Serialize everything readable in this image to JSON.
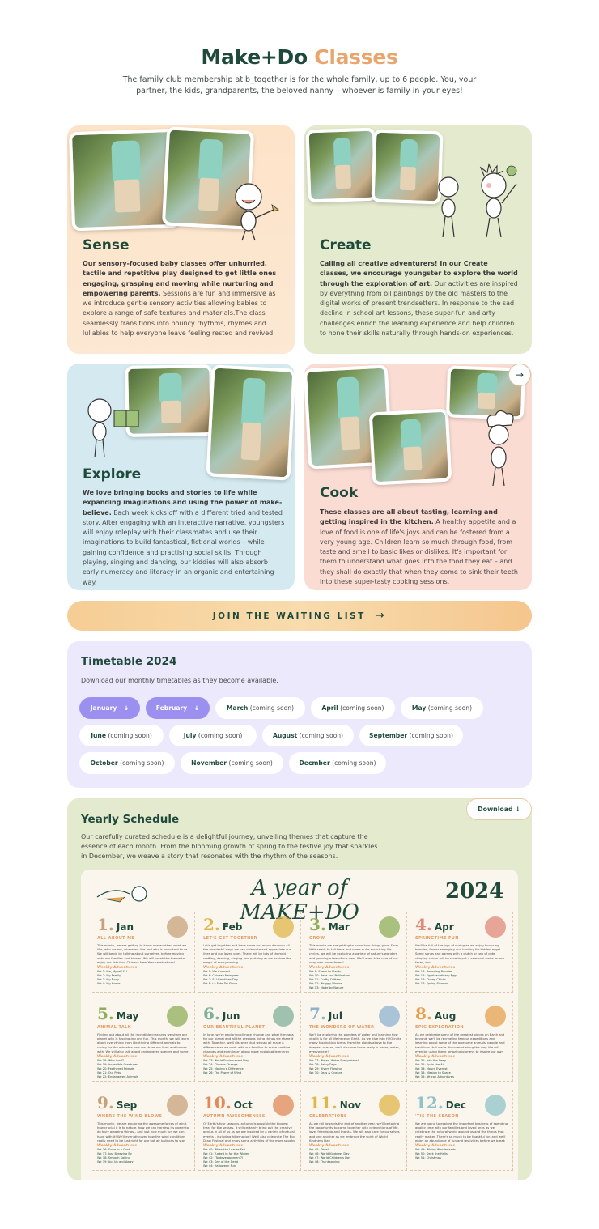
{
  "hero": {
    "title_main": "Make+Do",
    "title_accent": "Classes",
    "subtitle": "The family club membership at b_together is for the whole family, up to 6 people. You, your partner, the kids, grandparents, the beloved nanny – whoever is family in your eyes!"
  },
  "classes": [
    {
      "title": "Sense",
      "lead": "Our sensory-focused baby classes offer unhurried, tactile and repetitive play designed to get little ones engaging, grasping and moving while nurturing and empowering parents.",
      "body": " Sessions are fun and immersive as we introduce gentle sensory activities allowing babies to explore a range of safe textures and materials.The class seamlessly transitions into bouncy rhythms, rhymes and lullabies to help everyone leave feeling rested and revived."
    },
    {
      "title": "Create",
      "lead": "Calling all creative adventurers! In our Create classes, we encourage youngster to explore the world through the exploration of art.",
      "body": " Our activities are inspired by everything from oil paintings by the old masters to the digital works of present trendsetters. In response to the sad decline in school art lessons, these super-fun and arty challenges enrich the learning experience and help children to hone their skills naturally through hands-on experiences."
    },
    {
      "title": "Explore",
      "lead": "We love bringing books and stories to life while expanding imaginations and using the power of make-believe.",
      "body": " Each week kicks off with a different tried and tested story. After engaging with an interactive narrative, youngsters will enjoy roleplay with their classmates and use their imaginations to build fantastical, fictional worlds – while gaining confidence and practising social skills. Through playing, singing and dancing, our kiddies will also absorb early numeracy and literacy in an organic and entertaining way."
    },
    {
      "title": "Cook",
      "lead": "These classes are all about tasting, learning and getting inspired in the kitchen.",
      "body": " A healthy appetite and a love of food is one of life's joys and can be fostered from a very young age. Children learn so much through food, from taste and smell to basic likes or dislikes. It's important for them to understand what goes into the food they eat – and they shall do exactly that when they come to sink their teeth into these super-tasty cooking sessions."
    }
  ],
  "carousel": {
    "next_icon": "→"
  },
  "join": {
    "label": "JOIN THE WAITING LIST",
    "icon": "→"
  },
  "timetable": {
    "title": "Timetable 2024",
    "note": "Download our monthly timetables as they become available.",
    "months": [
      {
        "name": "January",
        "status": "",
        "icon": "↓"
      },
      {
        "name": "February",
        "status": "",
        "icon": "↓"
      },
      {
        "name": "March",
        "status": "(coming soon)"
      },
      {
        "name": "April",
        "status": "(coming soon)"
      },
      {
        "name": "May",
        "status": "(coming soon)"
      },
      {
        "name": "June",
        "status": "(coming soon)"
      },
      {
        "name": "July",
        "status": "(coming soon)"
      },
      {
        "name": "August",
        "status": "(coming soon)"
      },
      {
        "name": "September",
        "status": "(coming soon)"
      },
      {
        "name": "October",
        "status": "(coming soon)"
      },
      {
        "name": "November",
        "status": "(coming soon)"
      },
      {
        "name": "Decmber",
        "status": "(coming soon)"
      }
    ]
  },
  "yearly": {
    "title": "Yearly Schedule",
    "desc": "Our carefully curated schedule is a delightful journey, unveiling themes that capture the essence of each month. From the blooming growth of spring to the festive joy that sparkles in December, we weave a story that resonates with the rhythm of the seasons.",
    "download_label": "Download",
    "download_icon": "↓",
    "poster": {
      "title": "A year of MAKE+DO",
      "year": "2024",
      "weekly_label": "Weekly Adventures",
      "months": [
        {
          "num": "1.",
          "name": "Jan",
          "theme": "ALL ABOUT ME",
          "color": "#c5a27a",
          "body": "This month, we are getting to know one another, what we like, who we are, where we live and who is important to us. We will begin by talking about ourselves, before moving onto our families and homes. We will break the theme to enjoy our fabulous Chinese New Year celebrations!",
          "weeks": [
            "Wk 1: Me, Myself & I",
            "Wk 2: My Family",
            "Wk 3: My Body",
            "Wk 4: My Home"
          ]
        },
        {
          "num": "2.",
          "name": "Feb",
          "theme": "LET'S GET TOGETHER",
          "color": "#e0b54a",
          "body": "Let's get together and have some fun as we discover all the wonderful ways we can celebrate and appreciate our lives and our loved ones. There will be lots of themed crafting, dancing, singing and partying as we explore the magic of merrymaking.",
          "weeks": [
            "Wk 5: We Connect",
            "Wk 6: Chinese New year",
            "Wk 7: St Valentines Day",
            "Wk 8: La Fete Du Slinos"
          ]
        },
        {
          "num": "3.",
          "name": "Mar",
          "theme": "GROW",
          "color": "#8fae5a",
          "body": "This month we are getting to know how things grow. From little seeds to tall trees and some quite surprising life cycles, we will be exploring a variety of nature's wonders and growing a few of our own. We'll even take care of our very own worm farms!",
          "weeks": [
            "Wk 9: Seeds to Plants",
            "Wk 10: Bees and Pollinators",
            "Wk 11: Crafty Critters",
            "Wk 12: Wriggly Worms",
            "Wk 13: Made by Nature"
          ]
        },
        {
          "num": "4.",
          "name": "Apr",
          "theme": "SPRINGTIME FUN",
          "color": "#e08a7a",
          "body": "We'll be full of the joys of spring as we enjoy bouncing bunnies, flower arranging and hunting for hidden eggs! Some songs and games with a clutch or two of cute chirping chicks will be sure to put a seasonal smile on our faces, too!",
          "weeks": [
            "Wk 14: Bouncing Bunnies",
            "Wk 15: Eggstraordinary Eggs",
            "Wk 16: Cheep Chicks",
            "Wk 17: Spring Flowers"
          ]
        },
        {
          "num": "5.",
          "name": "May",
          "theme": "ANIMAL TALK",
          "color": "#8fae5a",
          "body": "Finding out about all the incredible creatures we share our planet with is fascinating and fun. This month, we will learn about everything from identifying different animals to caring for the adorable pets we share our lives and homes with. We will also talk about endangered species and some of the things we can all do to support their conservation.",
          "weeks": [
            "Wk 18: Who Am I?",
            "Wk 19: Incredible Creatures",
            "Wk 20: Feathered Friends",
            "Wk 21: Our Pets",
            "Wk 22: Endangered Animals"
          ]
        },
        {
          "num": "6.",
          "name": "Jun",
          "theme": "OUR BEAUTIFUL PLANET",
          "color": "#7fb09a",
          "body": "In June, we're exploring climate change and what it means for our planet and all the precious living things we share it with. Together, we'll discover that we can all make a difference as we work with our families to make positive changes and even learn about more sustainable energy sources.",
          "weeks": [
            "Wk 23: World Environment Day",
            "Wk 24: Climate Change",
            "Wk 25: Making a Difference",
            "Wk 26: The Power of Wind"
          ]
        },
        {
          "num": "7.",
          "name": "Jul",
          "theme": "THE WONDERS OF WATER",
          "color": "#8fb3cf",
          "body": "We'll be exploring the wonders of water and learning how vital it is for all life here on Earth. As we dive into H2O in its many fascinating forms, from the clouds above to the deepest oceans, we'll discover there really is water, water, everywhere!",
          "weeks": [
            "Wk 27: Water, Water Everywhere!",
            "Wk 28: Rainy Days",
            "Wk 29: Rivers Flowing",
            "Wk 30: Seas & Oceans"
          ]
        },
        {
          "num": "8.",
          "name": "Aug",
          "theme": "EPIC EXPLORATION",
          "color": "#e6a14f",
          "body": "As we celebrate some of the greatest places on Earth and beyond, we'll be recreating famous expeditions and learning about some of the awesome animals, people and traditions that we're discovered along the way. We will even be using these amazing journeys to inspire our own daring adventures!",
          "weeks": [
            "Wk 31: Into the Deep",
            "Wk 32: Up in the Air",
            "Wk 33: Mount Everest",
            "Wk 34: Mission to Space",
            "Wk 35: African Adventures"
          ]
        },
        {
          "num": "9.",
          "name": "Sep",
          "theme": "WHERE THE WIND BLOWS",
          "color": "#c5a27a",
          "body": "This month, we are exploring the awesome forces of wind, how crucial it is to nature, how we can harness its power to do truly amazing things – and just how much fun we can have with it! We'll even discover how the wind conditions really need to be just right for our hot air balloons to stay on course!",
          "weeks": [
            "Wk 36: Gone in a Gust",
            "Wk 37: Just Breezing By",
            "Wk 38: Smooth Sailing",
            "Wk 39: Up, Up and Away!"
          ]
        },
        {
          "num": "10.",
          "name": "Oct",
          "theme": "AUTUMN AWESOMENESS",
          "color": "#e08a5a",
          "body": "Of Earth's four seasons, autumn is possibly the biggest treat for the senses. It will certainly bring out the creative genius in all of us as we are inspired by a variety of natural events – including hibernation! We'll also celebrate The Big Draw Festival and enjoy some activities of the more spooky variety.",
          "weeks": [
            "Wk 40: When the Leaves Fall",
            "Wk 41: Tucked in for the Winter",
            "Wk 42: (To developpment?)",
            "Wk 43: Day of the Dead",
            "Wk 44: Halloween Fun"
          ]
        },
        {
          "num": "11.",
          "name": "Nov",
          "theme": "CELEBRATIONS",
          "color": "#e0b54a",
          "body": "As we roll towards the end of another year, we'll be taking the opportunity to come together with celebrations of life, love, friendship and thanks. We will also care for ourselves and one another as we embrace the spirit of World Kindness Day.",
          "weeks": [
            "Wk 45: Diwali",
            "Wk 46: World Kindness Day",
            "Wk 47: World Children's Day",
            "Wk 48: Thanksgiving"
          ]
        },
        {
          "num": "12.",
          "name": "Dec",
          "theme": "'TIS THE SEASON",
          "color": "#8fc3c8",
          "body": "We are going to explore the important business of spending quality time with our families and loved ones as we celebrate the natural world around us and the things that really matter. There's so much to be thankful for, and we'll enjoy an abundance of fun and festivities before we break for a brand new year.",
          "weeks": [
            "Wk 49: Wintry Wonderlands",
            "Wk 50: Deck the Halls",
            "Wk 51: Christmas"
          ]
        }
      ]
    }
  }
}
